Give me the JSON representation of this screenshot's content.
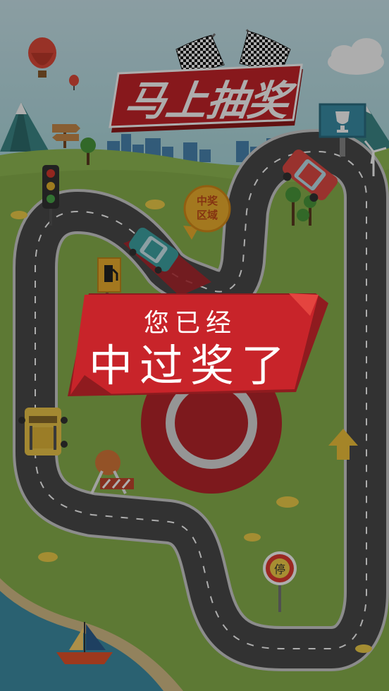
{
  "title": "马上抽奖",
  "prize_zone_label_line1": "中奖",
  "prize_zone_label_line2": "区域",
  "stop_sign_text": "停",
  "result_banner": {
    "line1": "您已经",
    "line2": "中过奖了"
  },
  "icons": [
    "checkered-flags-icon",
    "hot-air-balloon-icon",
    "traffic-light-icon",
    "trophy-billboard-icon",
    "gas-station-icon",
    "road-barrier-icon",
    "up-arrow-icon",
    "stop-sign-icon",
    "sailboat-icon",
    "wind-turbine-icon"
  ],
  "colors": {
    "banner_red": "#c8242a",
    "sky": "#b7dbe6",
    "grass": "#8db64f",
    "road": "#4a4a4a",
    "lake": "#3e8fa7"
  }
}
